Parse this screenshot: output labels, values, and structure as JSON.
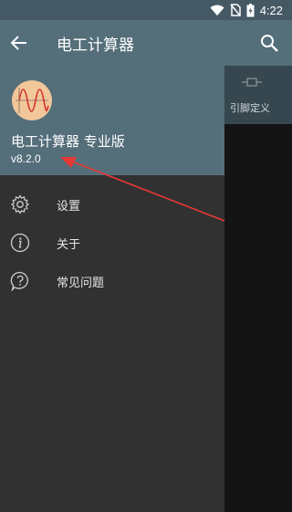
{
  "status_bar": {
    "time": "4:22"
  },
  "app_bar": {
    "title": "电工计算器"
  },
  "background_tab": {
    "label": "引脚定义"
  },
  "drawer": {
    "header": {
      "title": "电工计算器 专业版",
      "version": "v8.2.0"
    },
    "items": [
      {
        "label": "设置",
        "icon": "gear-icon"
      },
      {
        "label": "关于",
        "icon": "info-icon"
      },
      {
        "label": "常见问题",
        "icon": "help-icon"
      }
    ]
  },
  "colors": {
    "appbar": "#546e7a",
    "statusbar": "#455965",
    "drawer_bg": "#313131",
    "annotation_arrow": "#e53935"
  }
}
